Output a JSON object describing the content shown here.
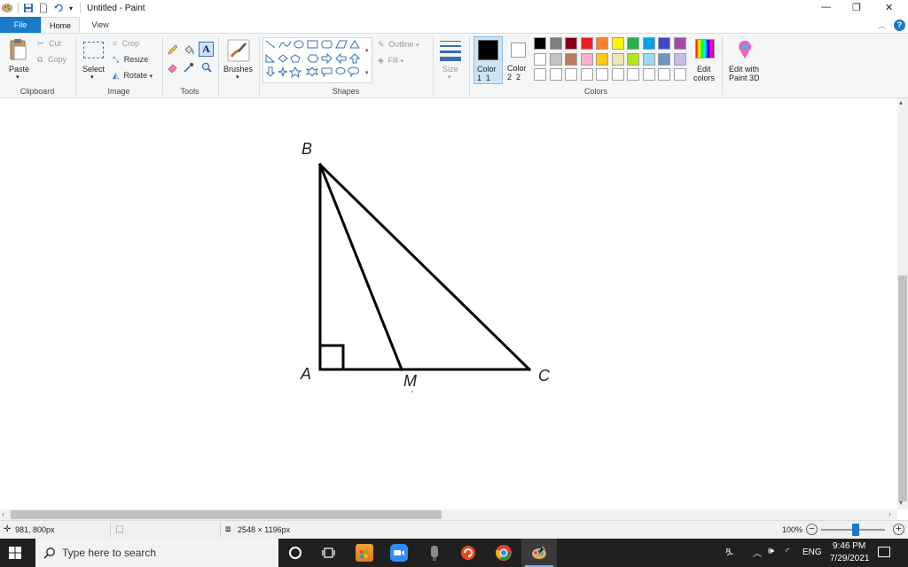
{
  "window": {
    "title": "Untitled - Paint",
    "controls": {
      "minimize": "—",
      "restore": "❐",
      "close": "✕"
    }
  },
  "tabs": [
    {
      "label": "File",
      "selected": false,
      "accent": "#1979ca"
    },
    {
      "label": "Home",
      "selected": true
    },
    {
      "label": "View",
      "selected": false
    }
  ],
  "ribbon": {
    "clipboard": {
      "paste": "Paste",
      "cut": "Cut",
      "copy": "Copy",
      "group": "Clipboard"
    },
    "image": {
      "select": "Select",
      "crop": "Crop",
      "resize": "Resize",
      "rotate": "Rotate",
      "group": "Image"
    },
    "tools": {
      "group": "Tools"
    },
    "brushes": {
      "label": "Brushes"
    },
    "shapes": {
      "outline": "Outline",
      "fill": "Fill",
      "group": "Shapes"
    },
    "size": {
      "label": "Size"
    },
    "colors": {
      "color1": "Color 1",
      "color1_num": "1",
      "color2": "Color 2",
      "color2_num": "2",
      "edit_colors": "Edit colors",
      "edit_paint3d": "Edit with Paint 3D",
      "group": "Colors",
      "color1_value": "#000000",
      "color2_value": "#ffffff",
      "palette_row1": [
        "#000000",
        "#7f7f7f",
        "#880015",
        "#ed1c24",
        "#ff7f27",
        "#fff200",
        "#22b14c",
        "#00a2e8",
        "#3f48cc",
        "#a349a4"
      ],
      "palette_row2": [
        "#ffffff",
        "#c3c3c3",
        "#b97a57",
        "#ffaec9",
        "#ffc90e",
        "#efe4b0",
        "#b5e61d",
        "#99d9ea",
        "#7092be",
        "#c8bfe7"
      ],
      "palette_row3": [
        "#ffffff",
        "#ffffff",
        "#ffffff",
        "#ffffff",
        "#ffffff",
        "#ffffff",
        "#ffffff",
        "#ffffff",
        "#ffffff",
        "#ffffff"
      ]
    }
  },
  "drawing": {
    "labels": {
      "b": "B",
      "a": "A",
      "m": "M",
      "c": "C"
    }
  },
  "status": {
    "cursor_pos": "981, 800px",
    "image_size": "2548 × 1196px",
    "zoom": "100%"
  },
  "taskbar": {
    "search_placeholder": "Type here to search",
    "lang": "ENG",
    "time": "9:46 PM",
    "date": "7/29/2021"
  }
}
